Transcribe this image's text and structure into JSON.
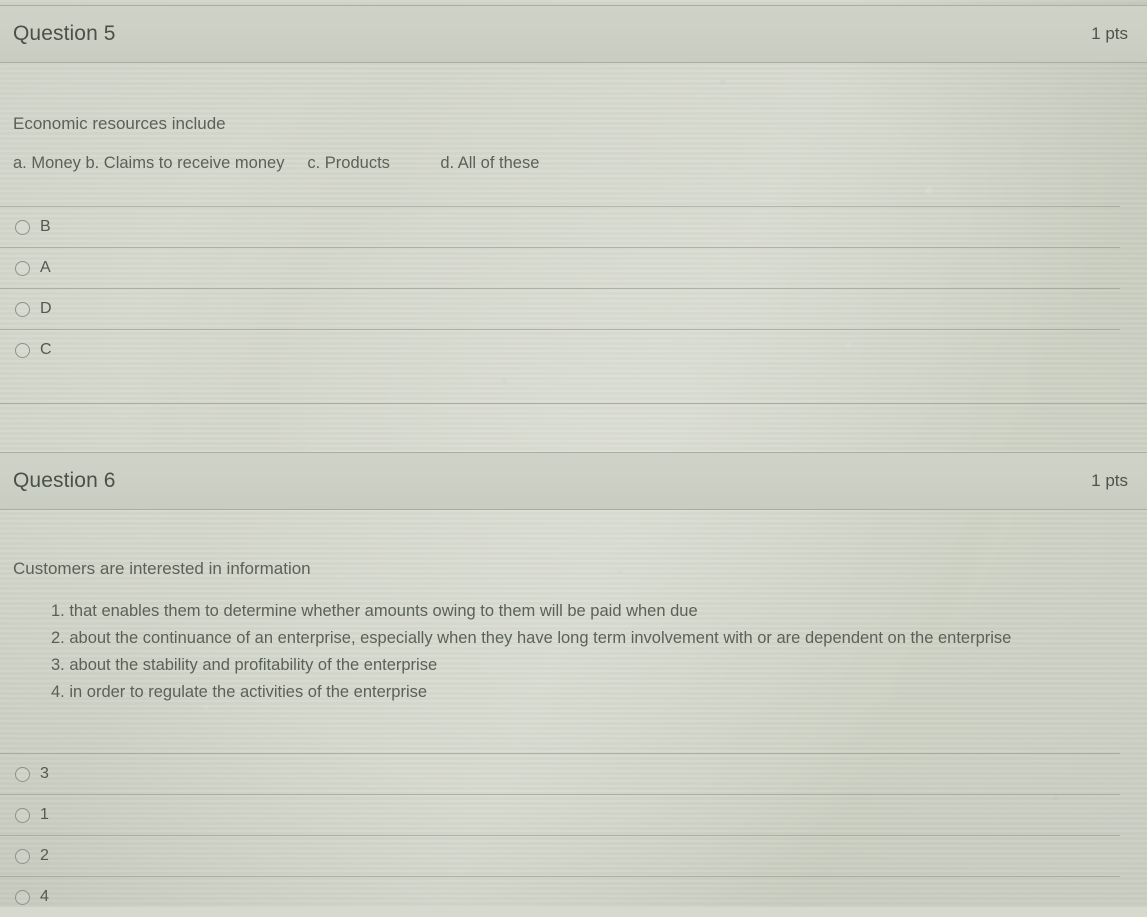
{
  "quiz": {
    "questions": [
      {
        "id": "question-5",
        "title": "Question 5",
        "points": "1 pts",
        "prompt": "Economic resources include",
        "subline": "a. Money b. Claims to receive money     c. Products           d. All of these",
        "options": [
          {
            "value": "B"
          },
          {
            "value": "A"
          },
          {
            "value": "D"
          },
          {
            "value": "C"
          }
        ]
      },
      {
        "id": "question-6",
        "title": "Question 6",
        "points": "1 pts",
        "prompt": "Customers are interested in information",
        "items": [
          "1. that enables them to determine whether amounts owing to them will be paid when due",
          "2. about the continuance of an enterprise, especially when they have long term involvement with or are dependent on the enterprise",
          "3. about the stability and profitability of the enterprise",
          "4. in order to regulate the activities of the enterprise"
        ],
        "options": [
          {
            "value": "3"
          },
          {
            "value": "1"
          },
          {
            "value": "2"
          },
          {
            "value": "4"
          }
        ]
      }
    ]
  },
  "colors": {
    "page_background": "#d6d9ce",
    "header_band": "#cdd1c5",
    "border": "#a9aea2",
    "text": "#5b6158",
    "title_text": "#4b5149"
  }
}
